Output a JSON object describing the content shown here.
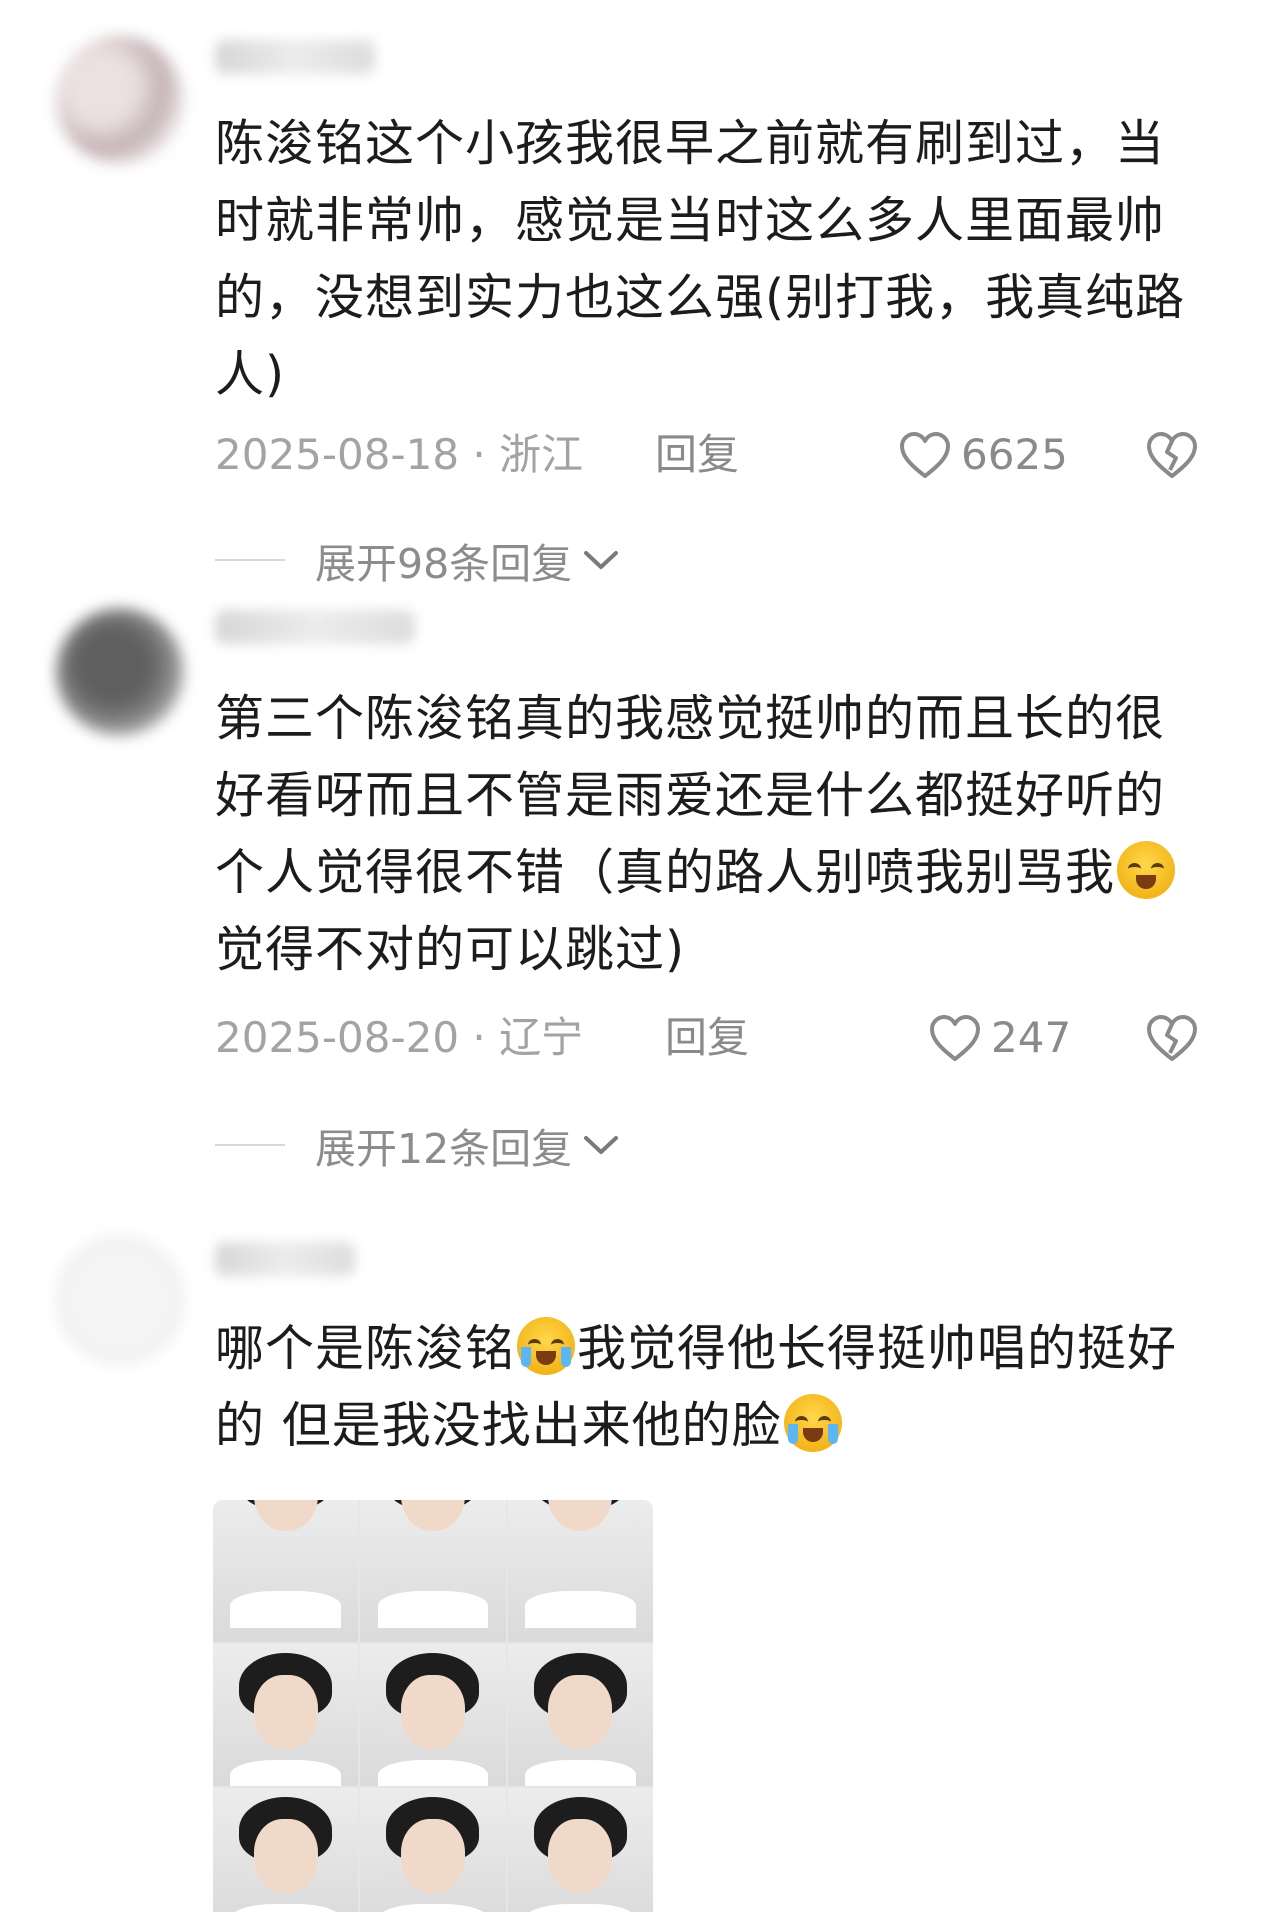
{
  "comments": [
    {
      "text": "陈浚铭这个小孩我很早之前就有刷到过，当时就非常帅，感觉是当时这么多人里面最帅的，没想到实力也这么强(别打我，我真纯路人)",
      "date": "2025-08-18 · 浙江",
      "reply_label": "回复",
      "likes": "6625",
      "expand_label": "展开98条回复"
    },
    {
      "text_part1": "第三个陈浚铭真的我感觉挺帅的而且长的很好看呀而且不管是雨爱还是什么都挺好听的个人觉得很不错（真的路人别喷我别骂我",
      "text_part2": "觉得不对的可以跳过)",
      "date": "2025-08-20 · 辽宁",
      "reply_label": "回复",
      "likes": "247",
      "expand_label": "展开12条回复"
    },
    {
      "text_part1": "哪个是陈浚铭",
      "text_part2": "我觉得他长得挺帅唱的挺好的  但是我没找出来他的脸",
      "image": "photo-grid"
    }
  ],
  "icons": {
    "like": "heart-outline-icon",
    "dislike": "broken-heart-icon",
    "expand": "chevron-down-icon",
    "emoji": "crying-face-emoji"
  },
  "colors": {
    "text": "#1c1c1c",
    "meta": "#a3a3a3",
    "action": "#8a8a8a"
  }
}
